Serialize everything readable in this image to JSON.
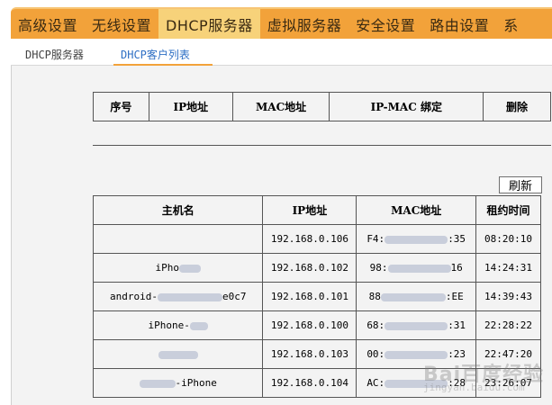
{
  "top_nav": [
    "高级设置",
    "无线设置",
    "DHCP服务器",
    "虚拟服务器",
    "安全设置",
    "路由设置",
    "系"
  ],
  "sub_nav": [
    "DHCP服务器",
    "DHCP客户列表"
  ],
  "bind_table": {
    "headers": [
      "序号",
      "IP地址",
      "MAC地址",
      "IP-MAC 绑定",
      "删除"
    ]
  },
  "refresh_label": "刷新",
  "client_table": {
    "headers": [
      "主机名",
      "IP地址",
      "MAC地址",
      "租约时间"
    ],
    "rows": [
      {
        "host_prefix": "",
        "host_suffix": "",
        "ip": "192.168.0.106",
        "mac_prefix": "F4:",
        "mac_suffix": ":35",
        "lease": "08:20:10"
      },
      {
        "host_prefix": "iPho",
        "host_suffix": "",
        "ip": "192.168.0.102",
        "mac_prefix": "98:",
        "mac_suffix": "16",
        "lease": "14:24:31"
      },
      {
        "host_prefix": "android-",
        "host_suffix": "e0c7",
        "ip": "192.168.0.101",
        "mac_prefix": "88",
        "mac_suffix": ":EE",
        "lease": "14:39:43"
      },
      {
        "host_prefix": "iPhone-",
        "host_suffix": "",
        "ip": "192.168.0.100",
        "mac_prefix": "68:",
        "mac_suffix": ":31",
        "lease": "22:28:22"
      },
      {
        "host_prefix": "",
        "host_suffix": "",
        "ip": "192.168.0.103",
        "mac_prefix": "00:",
        "mac_suffix": ":23",
        "lease": "22:47:20"
      },
      {
        "host_prefix": "",
        "host_suffix": "-iPhone",
        "ip": "192.168.0.104",
        "mac_prefix": "AC:",
        "mac_suffix": ":28",
        "lease": "23:26:07"
      }
    ]
  },
  "watermark": {
    "text": "Bai百度经验",
    "sub": "jingyan.baidu.com"
  }
}
